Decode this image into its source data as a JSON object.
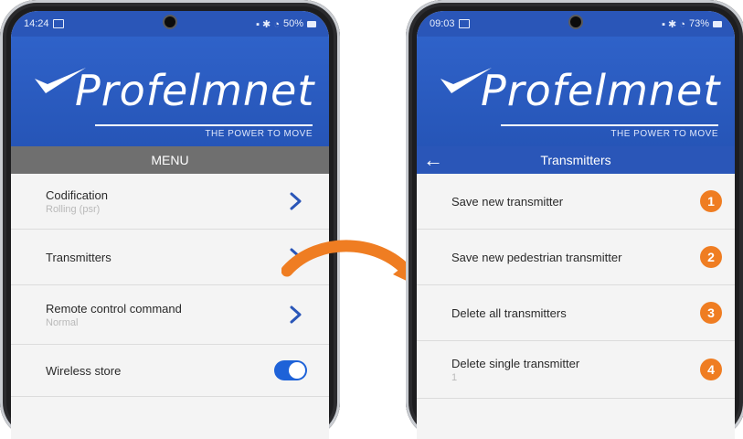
{
  "left_phone": {
    "status": {
      "time": "14:24",
      "battery": "50%"
    },
    "brand": {
      "name": "Profelmnet",
      "tagline": "THE POWER TO MOVE"
    },
    "header": {
      "title": "MENU"
    },
    "items": [
      {
        "label": "Codification",
        "sub": "Rolling (psr)",
        "control": "chevron"
      },
      {
        "label": "Transmitters",
        "sub": "",
        "control": "chevron"
      },
      {
        "label": "Remote control command",
        "sub": "Normal",
        "control": "chevron"
      },
      {
        "label": "Wireless store",
        "sub": "",
        "control": "toggle",
        "toggle_on": true
      }
    ]
  },
  "right_phone": {
    "status": {
      "time": "09:03",
      "battery": "73%"
    },
    "brand": {
      "name": "Profelmnet",
      "tagline": "THE POWER TO MOVE"
    },
    "header": {
      "title": "Transmitters"
    },
    "items": [
      {
        "label": "Save new transmitter",
        "badge": "1"
      },
      {
        "label": "Save new pedestrian transmitter",
        "badge": "2"
      },
      {
        "label": "Delete all transmitters",
        "badge": "3"
      },
      {
        "label": "Delete single transmitter",
        "sub": "1",
        "badge": "4"
      }
    ]
  },
  "colors": {
    "brand_blue": "#2a56b8",
    "menu_grey": "#6f6f6f",
    "accent_orange": "#ef7d22",
    "toggle_blue": "#1e62d8"
  },
  "icons": {
    "chevron": "chevron-right-icon",
    "back": "back-arrow-icon",
    "connector": "curved-arrow-icon"
  }
}
